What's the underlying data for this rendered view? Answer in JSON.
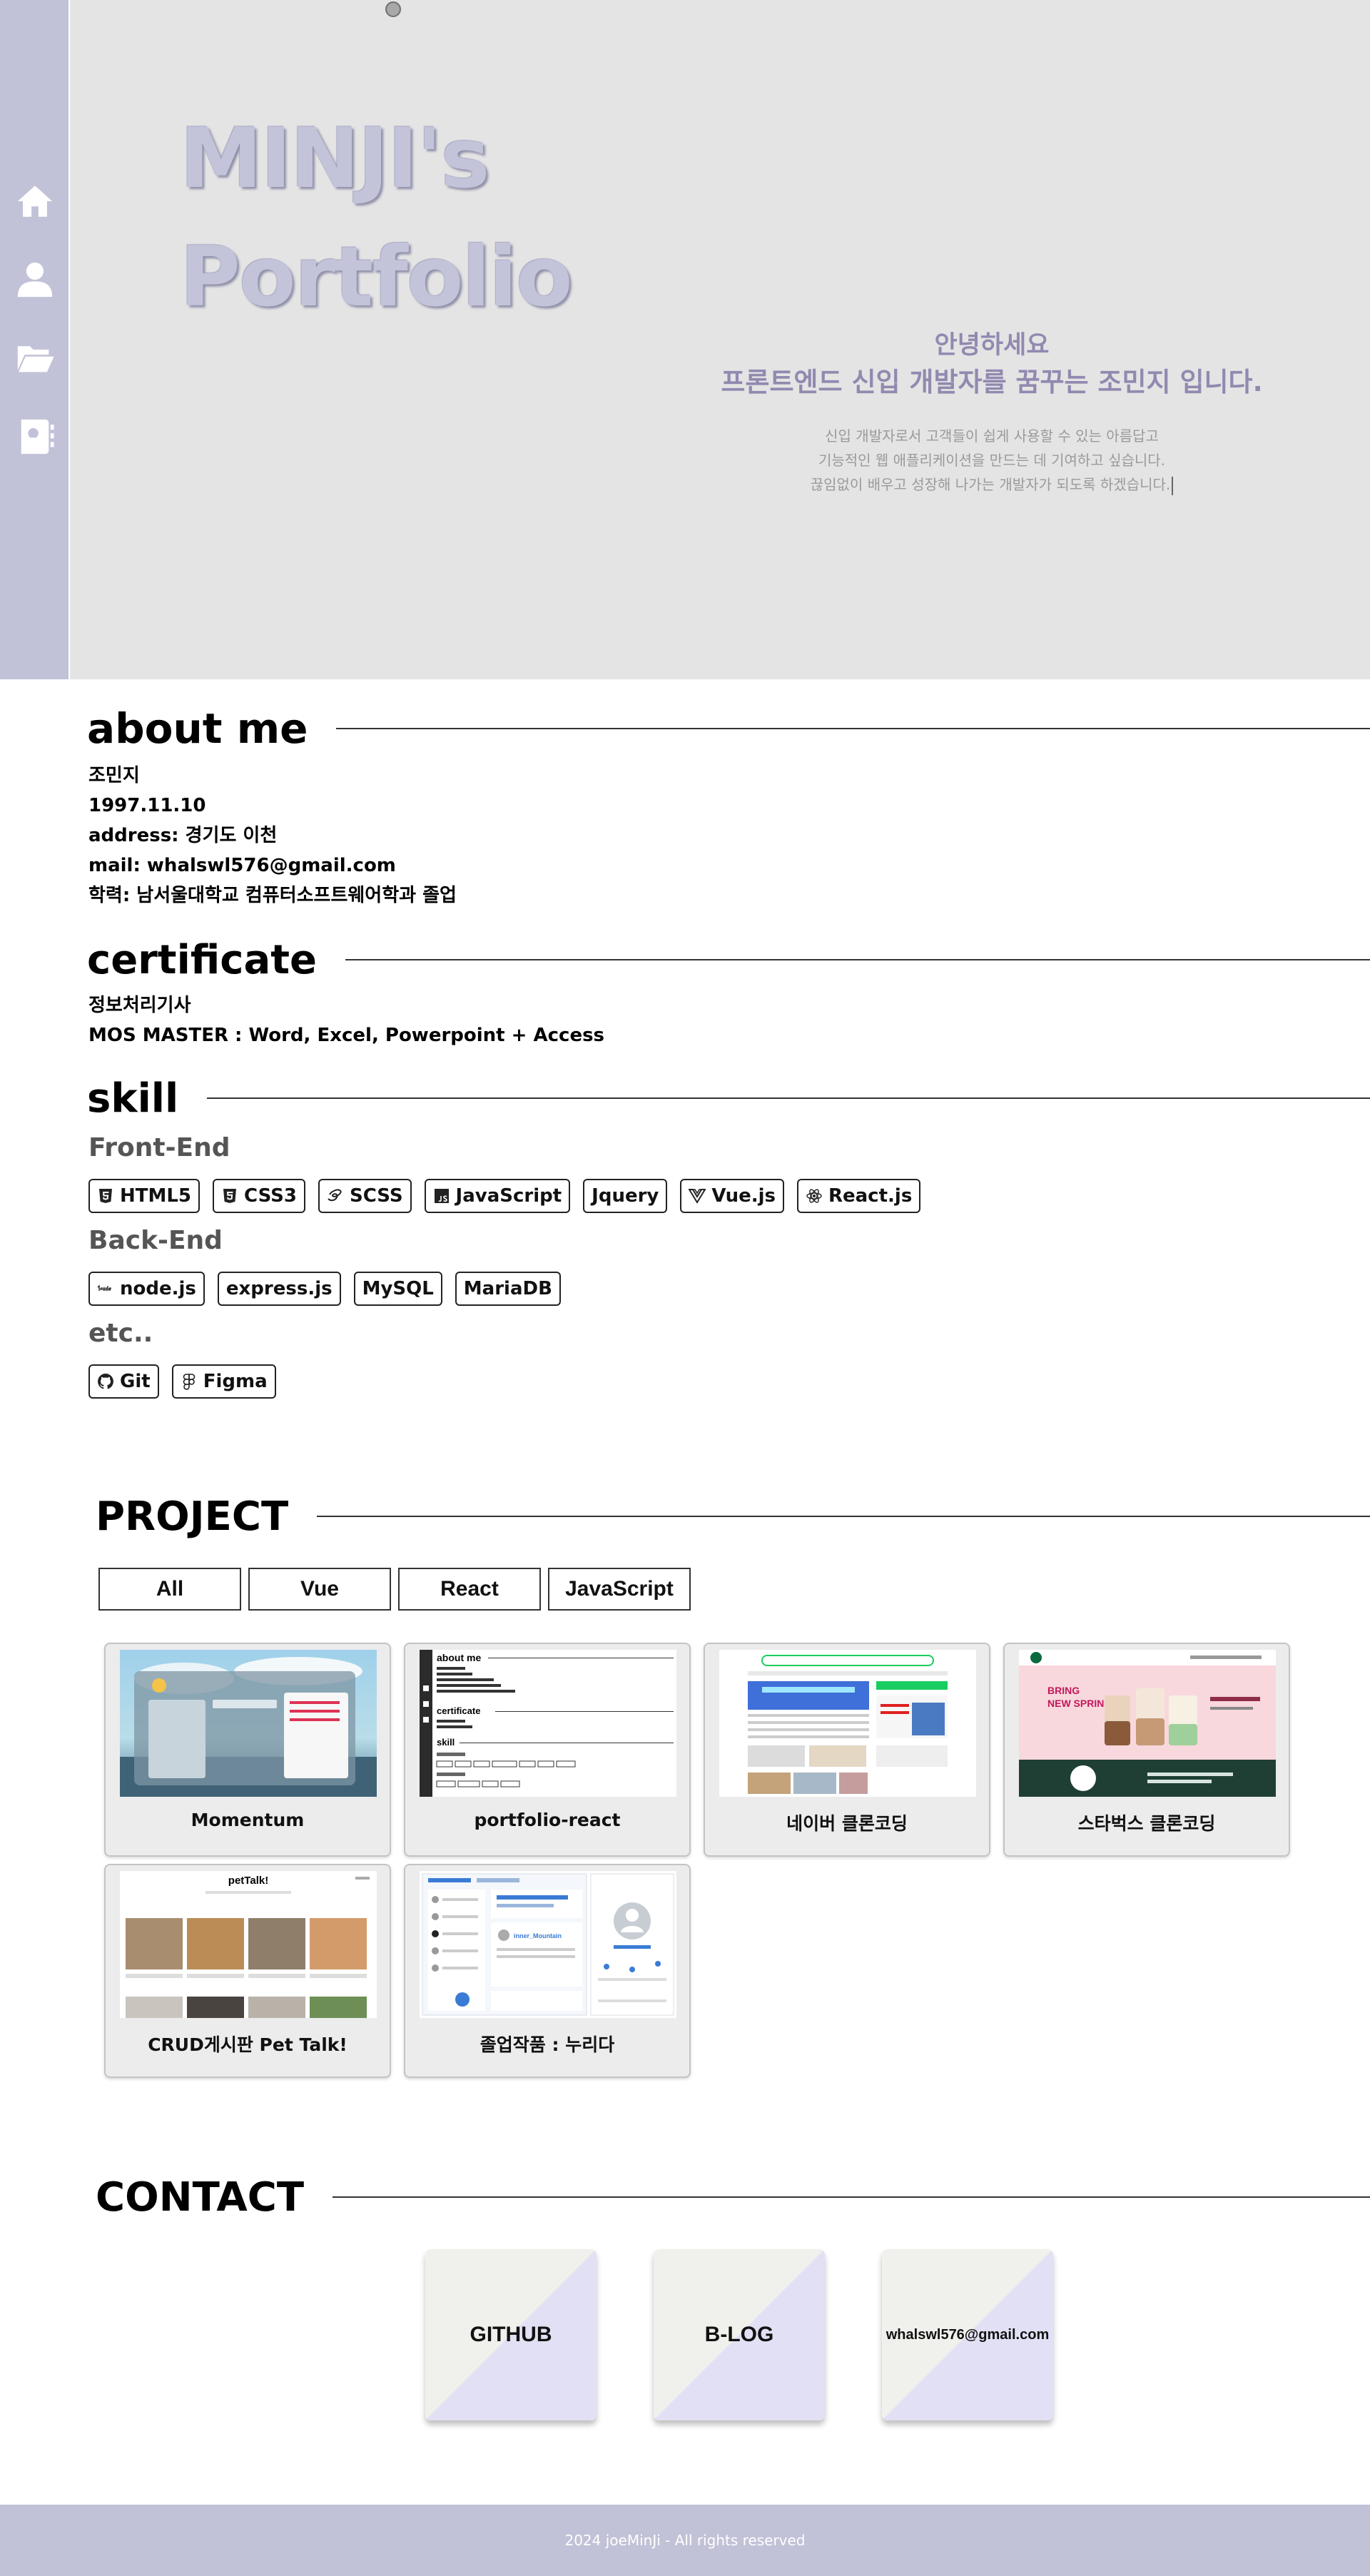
{
  "hero": {
    "title_line1": "MINJI's",
    "title_line2": "Portfolio",
    "greeting": "안녕하세요",
    "tagline": "프론트엔드 신입 개발자를 꿈꾸는 조민지 입니다.",
    "intro_line1": "신입 개발자로서 고객들이 쉽게 사용할 수 있는 아름답고",
    "intro_line2": "기능적인 웹 애플리케이션을 만드는 데 기여하고 싶습니다.",
    "intro_line3": "끊임없이 배우고 성장해 나가는 개발자가 되도록 하겠습니다."
  },
  "nav": {
    "items": [
      {
        "icon": "home-icon"
      },
      {
        "icon": "user-icon"
      },
      {
        "icon": "folder-open-icon"
      },
      {
        "icon": "address-book-icon"
      }
    ]
  },
  "about": {
    "heading": "about me",
    "name": "조민지",
    "birth": "1997.11.10",
    "address": "address: 경기도 이천",
    "mail": "mail: whalswl576@gmail.com",
    "education": "학력: 남서울대학교 컴퓨터소프트웨어학과 졸업"
  },
  "certificate": {
    "heading": "certificate",
    "items": [
      "정보처리기사",
      "MOS MASTER : Word, Excel, Powerpoint + Access"
    ]
  },
  "skill": {
    "heading": "skill",
    "frontend_label": "Front-End",
    "frontend": [
      "HTML5",
      "CSS3",
      "SCSS",
      "JavaScript",
      "Jquery",
      "Vue.js",
      "React.js"
    ],
    "backend_label": "Back-End",
    "backend": [
      "node.js",
      "express.js",
      "MySQL",
      "MariaDB"
    ],
    "etc_label": "etc..",
    "etc": [
      "Git",
      "Figma"
    ]
  },
  "project": {
    "heading": "PROJECT",
    "filters": [
      "All",
      "Vue",
      "React",
      "JavaScript"
    ],
    "cards": [
      "Momentum",
      "portfolio-react",
      "네이버 클론코딩",
      "스타벅스 클론코딩",
      "CRUD게시판 Pet Talk!",
      "졸업작품 : 누리다"
    ],
    "thumb_text": {
      "about": "about me",
      "certificate": "certificate",
      "skill": "skill",
      "starbucks_1": "BRING",
      "starbucks_2": "NEW SPRING",
      "pettalk": "petTalk!",
      "nurida_user": "inner_Mountain"
    }
  },
  "contact": {
    "heading": "CONTACT",
    "cards": [
      "GITHUB",
      "B-LOG",
      "whalswl576@gmail.com"
    ]
  },
  "footer": {
    "text": "2024 joeMinJi - All rights reserved"
  },
  "colors": {
    "hero_bg": "#e4e4e4",
    "sidebar": "#c1c1d7",
    "title": "#c3c3da",
    "greeting": "#9289b0",
    "footer": "#c1c1d7"
  }
}
